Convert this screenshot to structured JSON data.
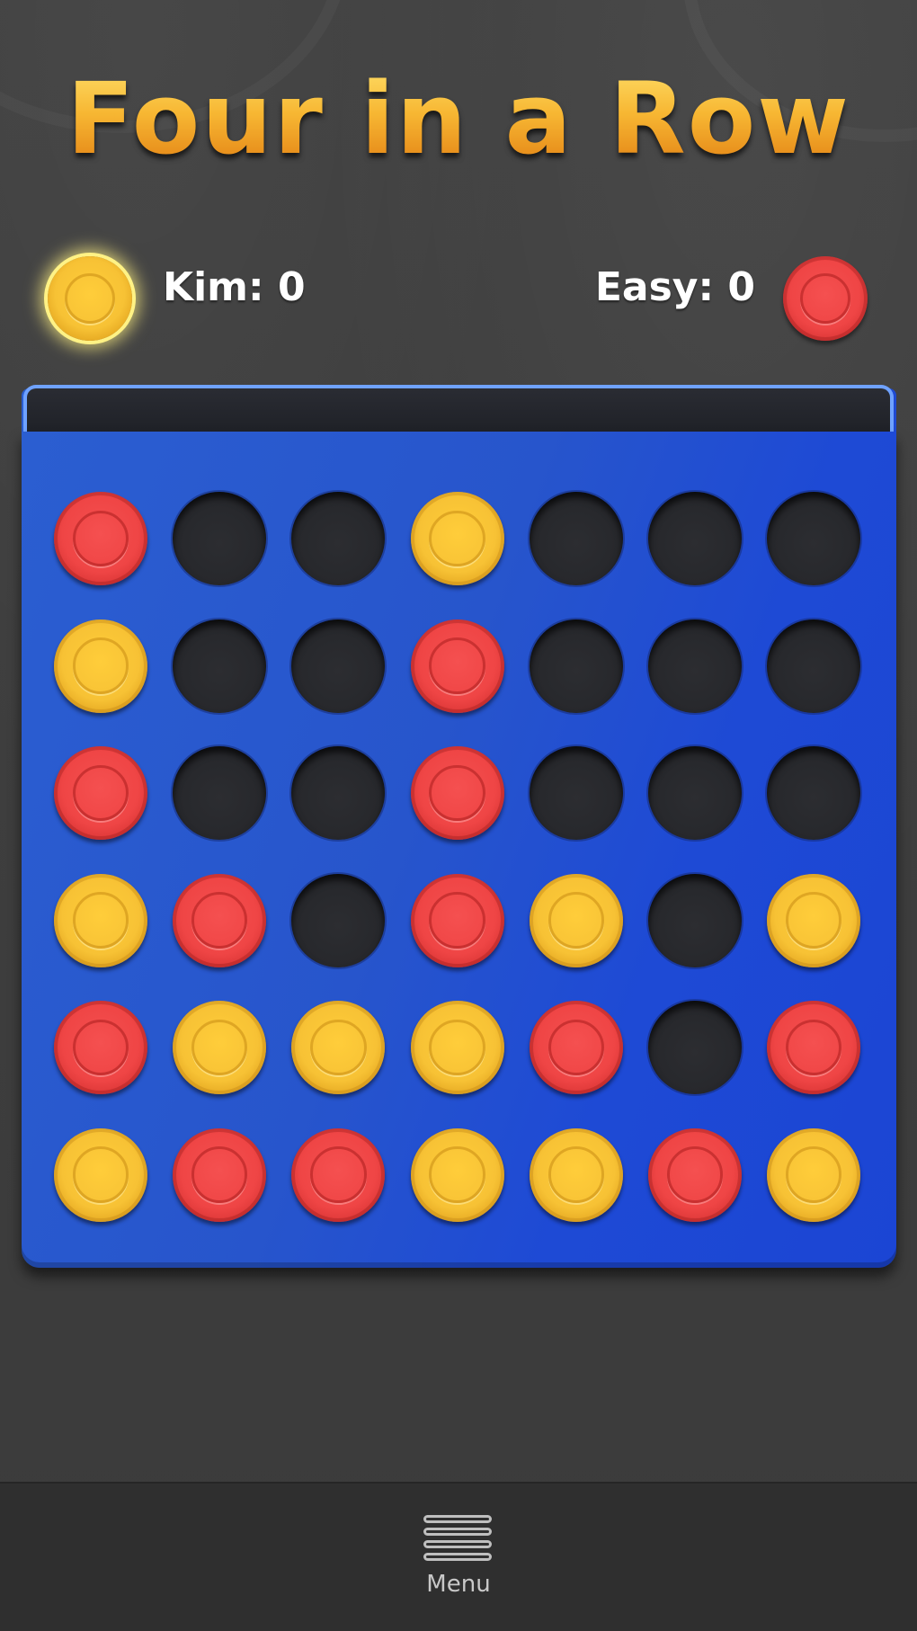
{
  "title": "Four in a Row",
  "players": {
    "p1": {
      "name_score": "Kim: 0",
      "disc": "yellow",
      "active": true
    },
    "p2": {
      "name_score": "Easy: 0",
      "disc": "red",
      "active": false
    }
  },
  "board": {
    "rows": 6,
    "cols": 7,
    "cells": [
      [
        "red",
        "empty",
        "empty",
        "yellow",
        "empty",
        "empty",
        "empty"
      ],
      [
        "yellow",
        "empty",
        "empty",
        "red",
        "empty",
        "empty",
        "empty"
      ],
      [
        "red",
        "empty",
        "empty",
        "red",
        "empty",
        "empty",
        "empty"
      ],
      [
        "yellow",
        "red",
        "empty",
        "red",
        "yellow",
        "empty",
        "yellow"
      ],
      [
        "red",
        "yellow",
        "yellow",
        "yellow",
        "red",
        "empty",
        "red"
      ],
      [
        "yellow",
        "red",
        "red",
        "yellow",
        "yellow",
        "red",
        "yellow"
      ]
    ]
  },
  "menu": {
    "label": "Menu",
    "icon": "hamburger-icon"
  },
  "colors": {
    "board": "#2755cc",
    "yellow_disc": "#f7c235",
    "red_disc": "#ef4545",
    "empty_hole": "#27282c",
    "title": "#f5a623"
  }
}
